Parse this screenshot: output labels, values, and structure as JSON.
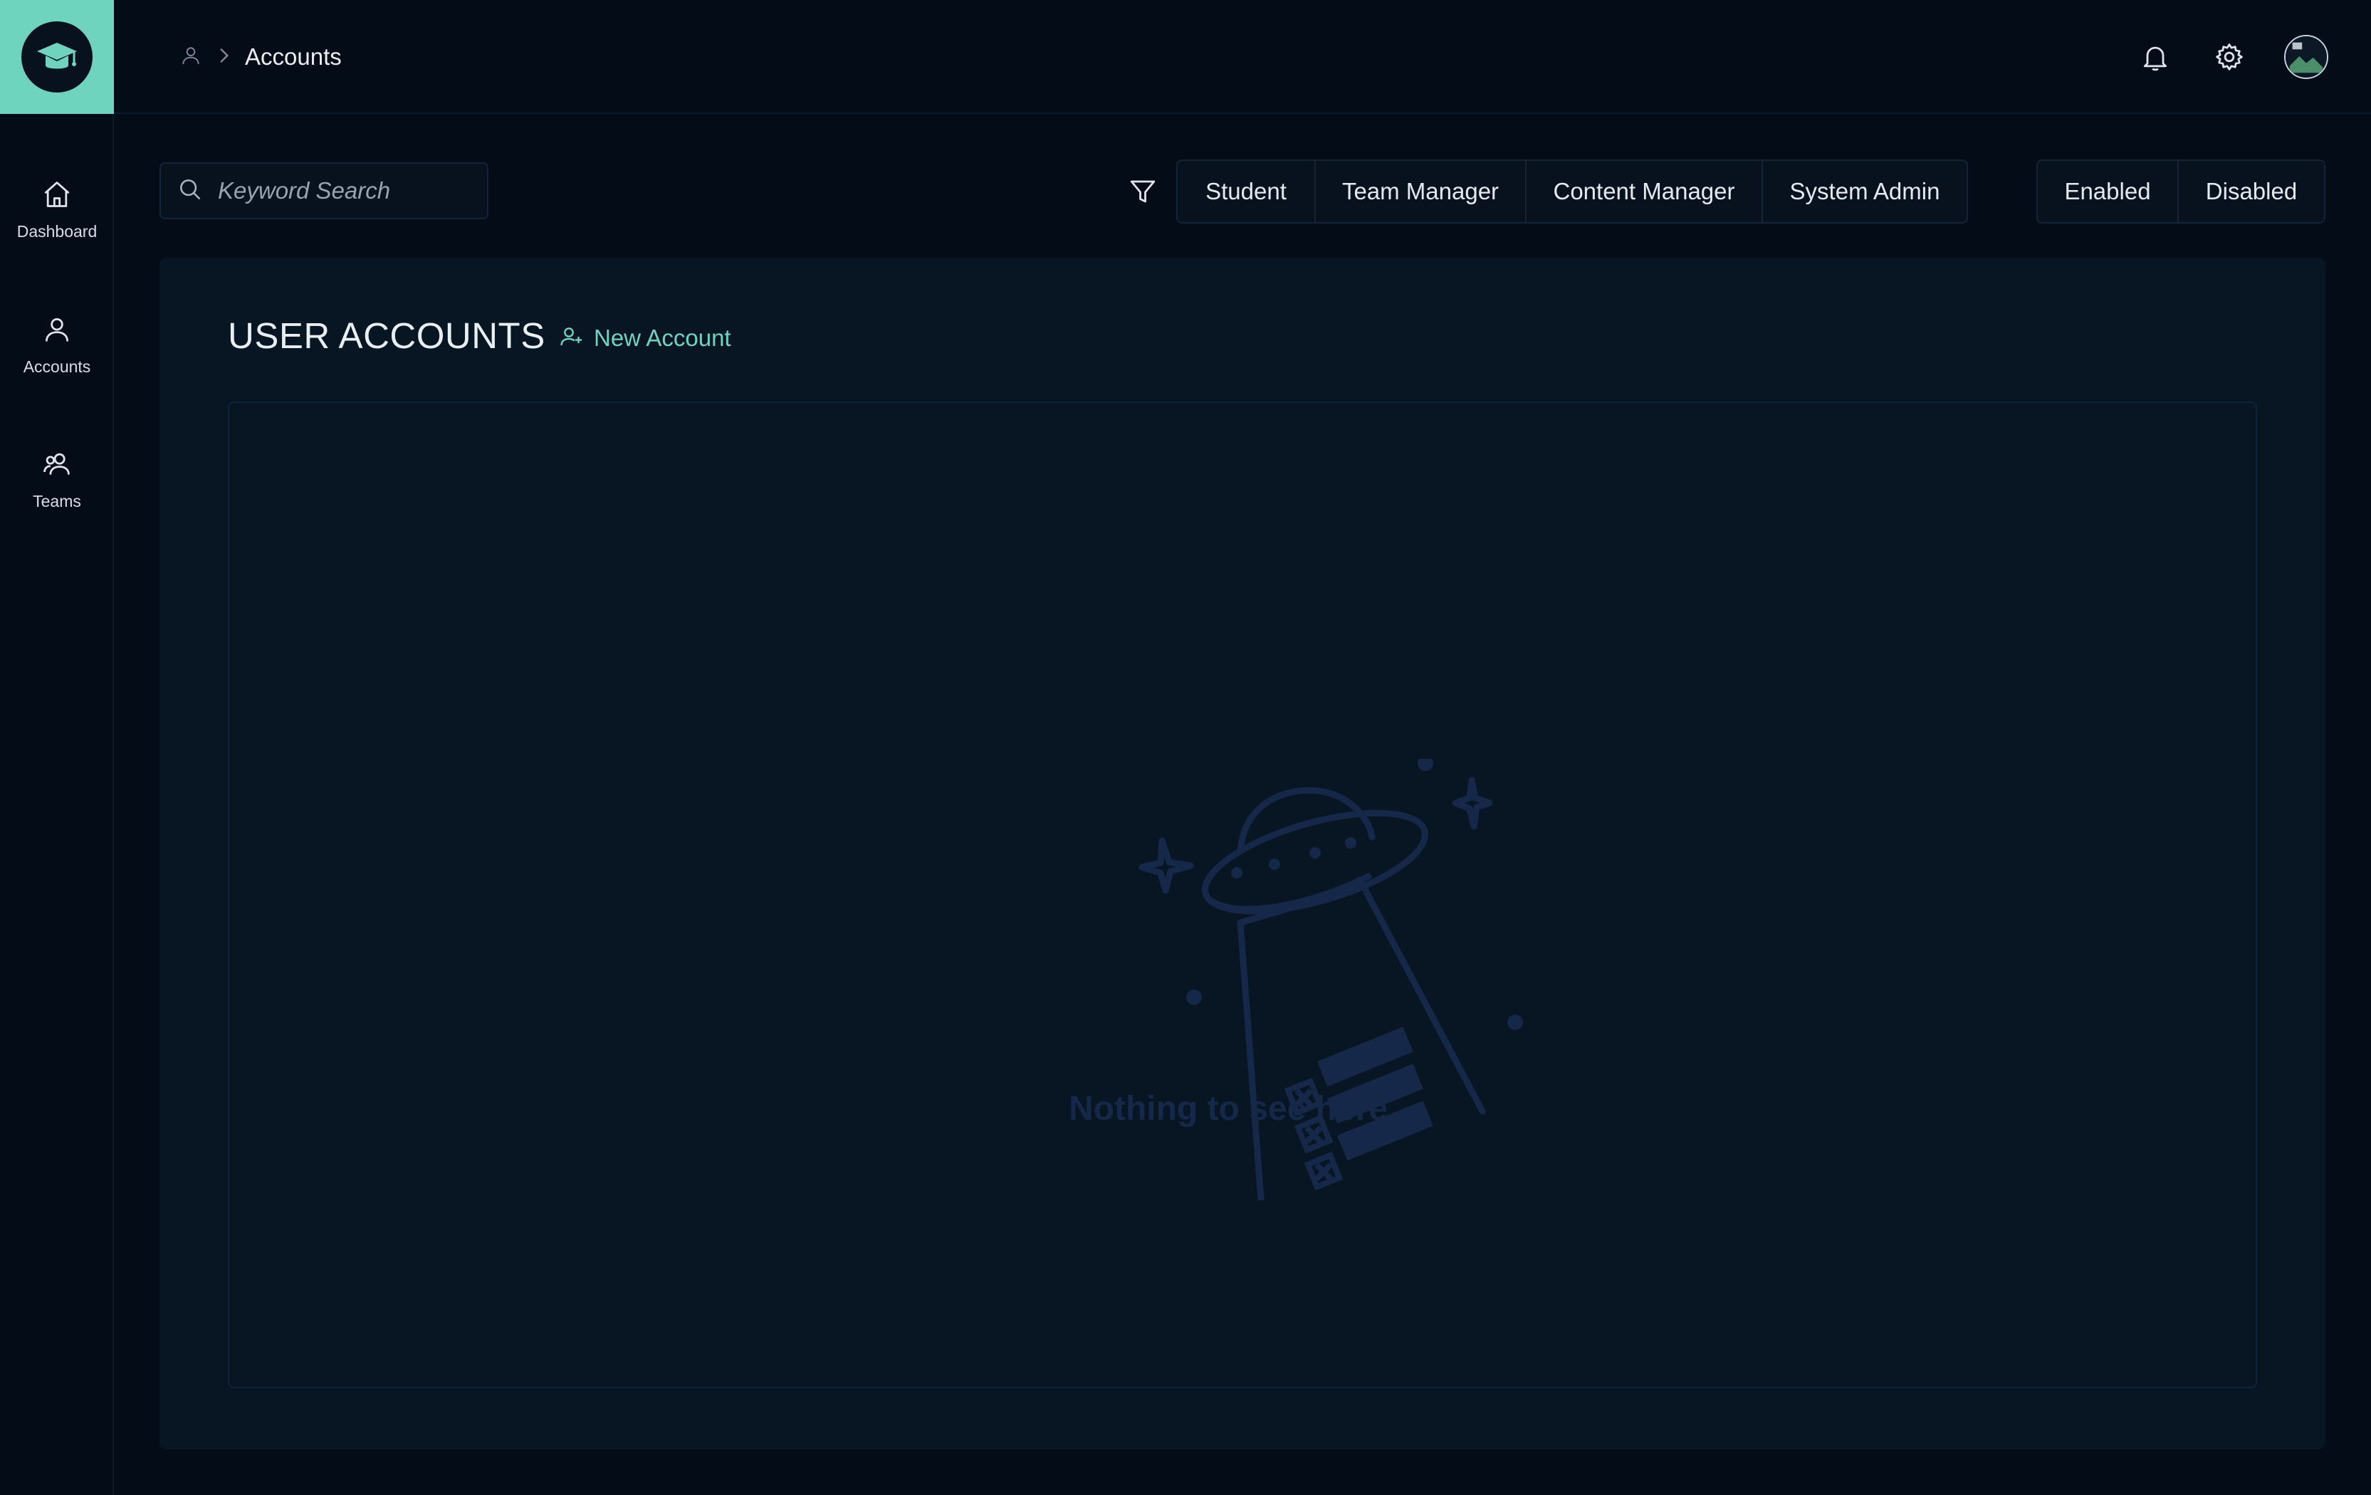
{
  "app": {
    "logo": "graduation-cap-logo"
  },
  "breadcrumb": {
    "icon": "user-icon",
    "separator": "chevron-right-icon",
    "current": "Accounts"
  },
  "header": {
    "icons": [
      "bell-icon",
      "gear-icon",
      "avatar"
    ]
  },
  "sidebar": {
    "items": [
      {
        "icon": "home-icon",
        "label": "Dashboard"
      },
      {
        "icon": "user-icon",
        "label": "Accounts"
      },
      {
        "icon": "users-icon",
        "label": "Teams"
      }
    ]
  },
  "toolbar": {
    "search_placeholder": "Keyword Search",
    "role_filters": [
      "Student",
      "Team Manager",
      "Content Manager",
      "System Admin"
    ],
    "status_filters": [
      "Enabled",
      "Disabled"
    ]
  },
  "main": {
    "title": "USER ACCOUNTS",
    "new_account_label": "New Account",
    "empty_message": "Nothing to see here..."
  },
  "colors": {
    "accent": "#6fd4bd",
    "background": "#030c17",
    "panel": "#081523",
    "empty_art": "#16284a"
  }
}
